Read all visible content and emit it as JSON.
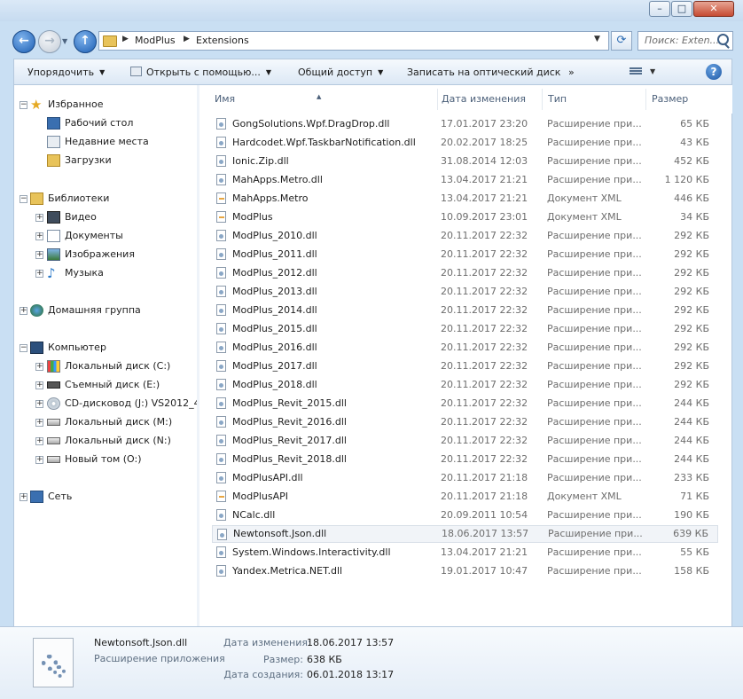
{
  "titlebar": {
    "min_label": "–",
    "max_label": "□",
    "close_label": "✕"
  },
  "address": {
    "segments": [
      "ModPlus",
      "Extensions"
    ]
  },
  "search": {
    "placeholder": "Поиск: Exten..."
  },
  "toolbar": {
    "organize": "Упорядочить",
    "open_with": "Открыть с помощью...",
    "share": "Общий доступ",
    "burn": "Записать на оптический диск",
    "more": "»",
    "help": "?"
  },
  "nav": {
    "favorites": {
      "label": "Избранное",
      "items": [
        "Рабочий стол",
        "Недавние места",
        "Загрузки"
      ]
    },
    "libraries": {
      "label": "Библиотеки",
      "items": [
        "Видео",
        "Документы",
        "Изображения",
        "Музыка"
      ]
    },
    "homegroup": "Домашняя группа",
    "computer": {
      "label": "Компьютер",
      "items": [
        "Локальный диск (C:)",
        "Съемный диск (E:)",
        "CD-дисковод (J:) VS2012_4",
        "Локальный диск (M:)",
        "Локальный диск (N:)",
        "Новый том (O:)"
      ]
    },
    "network": "Сеть"
  },
  "columns": {
    "name": "Имя",
    "date": "Дата изменения",
    "type": "Тип",
    "size": "Размер"
  },
  "files": [
    {
      "name": "GongSolutions.Wpf.DragDrop.dll",
      "date": "17.01.2017 23:20",
      "type": "Расширение при...",
      "size": "65 КБ"
    },
    {
      "name": "Hardcodet.Wpf.TaskbarNotification.dll",
      "date": "20.02.2017 18:25",
      "type": "Расширение при...",
      "size": "43 КБ"
    },
    {
      "name": "Ionic.Zip.dll",
      "date": "31.08.2014 12:03",
      "type": "Расширение при...",
      "size": "452 КБ"
    },
    {
      "name": "MahApps.Metro.dll",
      "date": "13.04.2017 21:21",
      "type": "Расширение при...",
      "size": "1 120 КБ"
    },
    {
      "name": "MahApps.Metro",
      "date": "13.04.2017 21:21",
      "type": "Документ XML",
      "size": "446 КБ"
    },
    {
      "name": "ModPlus",
      "date": "10.09.2017 23:01",
      "type": "Документ XML",
      "size": "34 КБ"
    },
    {
      "name": "ModPlus_2010.dll",
      "date": "20.11.2017 22:32",
      "type": "Расширение при...",
      "size": "292 КБ"
    },
    {
      "name": "ModPlus_2011.dll",
      "date": "20.11.2017 22:32",
      "type": "Расширение при...",
      "size": "292 КБ"
    },
    {
      "name": "ModPlus_2012.dll",
      "date": "20.11.2017 22:32",
      "type": "Расширение при...",
      "size": "292 КБ"
    },
    {
      "name": "ModPlus_2013.dll",
      "date": "20.11.2017 22:32",
      "type": "Расширение при...",
      "size": "292 КБ"
    },
    {
      "name": "ModPlus_2014.dll",
      "date": "20.11.2017 22:32",
      "type": "Расширение при...",
      "size": "292 КБ"
    },
    {
      "name": "ModPlus_2015.dll",
      "date": "20.11.2017 22:32",
      "type": "Расширение при...",
      "size": "292 КБ"
    },
    {
      "name": "ModPlus_2016.dll",
      "date": "20.11.2017 22:32",
      "type": "Расширение при...",
      "size": "292 КБ"
    },
    {
      "name": "ModPlus_2017.dll",
      "date": "20.11.2017 22:32",
      "type": "Расширение при...",
      "size": "292 КБ"
    },
    {
      "name": "ModPlus_2018.dll",
      "date": "20.11.2017 22:32",
      "type": "Расширение при...",
      "size": "292 КБ"
    },
    {
      "name": "ModPlus_Revit_2015.dll",
      "date": "20.11.2017 22:32",
      "type": "Расширение при...",
      "size": "244 КБ"
    },
    {
      "name": "ModPlus_Revit_2016.dll",
      "date": "20.11.2017 22:32",
      "type": "Расширение при...",
      "size": "244 КБ"
    },
    {
      "name": "ModPlus_Revit_2017.dll",
      "date": "20.11.2017 22:32",
      "type": "Расширение при...",
      "size": "244 КБ"
    },
    {
      "name": "ModPlus_Revit_2018.dll",
      "date": "20.11.2017 22:32",
      "type": "Расширение при...",
      "size": "244 КБ"
    },
    {
      "name": "ModPlusAPI.dll",
      "date": "20.11.2017 21:18",
      "type": "Расширение при...",
      "size": "233 КБ"
    },
    {
      "name": "ModPlusAPI",
      "date": "20.11.2017 21:18",
      "type": "Документ XML",
      "size": "71 КБ"
    },
    {
      "name": "NCalc.dll",
      "date": "20.09.2011 10:54",
      "type": "Расширение при...",
      "size": "190 КБ"
    },
    {
      "name": "Newtonsoft.Json.dll",
      "date": "18.06.2017 13:57",
      "type": "Расширение при...",
      "size": "639 КБ"
    },
    {
      "name": "System.Windows.Interactivity.dll",
      "date": "13.04.2017 21:21",
      "type": "Расширение при...",
      "size": "55 КБ"
    },
    {
      "name": "Yandex.Metrica.NET.dll",
      "date": "19.01.2017 10:47",
      "type": "Расширение при...",
      "size": "158 КБ"
    }
  ],
  "details": {
    "name": "Newtonsoft.Json.dll",
    "type": "Расширение приложения",
    "modified_label": "Дата изменения:",
    "modified": "18.06.2017 13:57",
    "size_label": "Размер:",
    "size": "638 КБ",
    "created_label": "Дата создания:",
    "created": "06.01.2018 13:17"
  }
}
